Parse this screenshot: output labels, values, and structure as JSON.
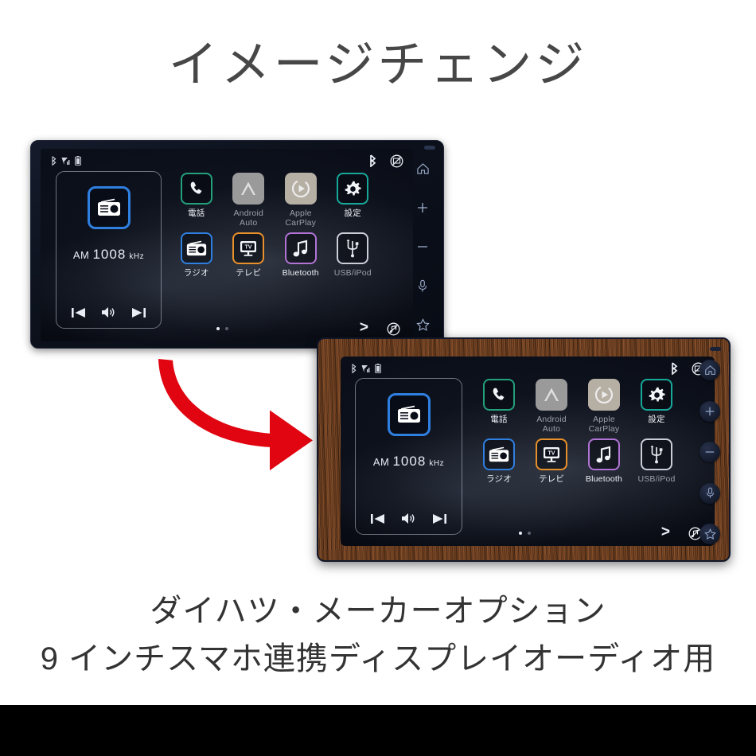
{
  "page": {
    "title": "イメージチェンジ",
    "caption_line1": "ダイハツ・メーカーオプション",
    "caption_line2": "9 インチスマホ連携ディスプレイオーディオ用"
  },
  "colors": {
    "title_text": "#474747",
    "caption_text": "#333333",
    "arrow_red": "#E00510",
    "accent_radio_blue": "#2F7FE0",
    "accent_phone_green": "#23A07C",
    "accent_settings_teal": "#18A89B",
    "accent_tv_orange": "#E8902A",
    "accent_bluetooth_purple": "#B173D6",
    "accent_usb_grey": "#C9CED8",
    "bezel_dark": "#0C111C",
    "bezel_wood": "#7A4522",
    "bottom_bar": "#000000"
  },
  "units": [
    {
      "variant": "dark",
      "bezel_label": "black-bezel",
      "statusbar": {
        "left_icons": [
          "bluetooth-icon",
          "signal-bars-icon",
          "battery-icon"
        ],
        "right_icons": [
          "bluetooth-icon",
          "no-display-icon"
        ]
      },
      "widget": {
        "source_icon": "radio-icon",
        "band": "AM",
        "frequency": "1008",
        "frequency_unit": "kHz",
        "controls": [
          "previous-track-icon",
          "volume-icon",
          "next-track-icon"
        ]
      },
      "apps": [
        {
          "label": "電話",
          "icon": "phone-icon",
          "style": "outlined",
          "color": "#23A07C",
          "dim": false
        },
        {
          "label": "Android\nAuto",
          "icon": "android-auto-icon",
          "style": "filled",
          "color": "#9A9A9A",
          "dim": true
        },
        {
          "label": "Apple\nCarPlay",
          "icon": "carplay-icon",
          "style": "filled",
          "color": "#B6AFA4",
          "dim": true
        },
        {
          "label": "設定",
          "icon": "gear-icon",
          "style": "outlined",
          "color": "#18A89B",
          "dim": false
        },
        {
          "label": "ラジオ",
          "icon": "radio-icon",
          "style": "outlined",
          "color": "#2F7FE0",
          "dim": false
        },
        {
          "label": "テレビ",
          "icon": "tv-icon",
          "style": "outlined",
          "color": "#E8902A",
          "dim": false
        },
        {
          "label": "Bluetooth",
          "icon": "music-note-icon",
          "style": "outlined",
          "color": "#B173D6",
          "dim": false
        },
        {
          "label": "USB/iPod",
          "icon": "usb-icon",
          "style": "outlined",
          "color": "#C9CED8",
          "dim": true
        }
      ],
      "footer": {
        "page_dots_total": 2,
        "page_dots_active": 1,
        "next_page_label": ">",
        "mute_icon": "mute-music-icon"
      },
      "hardware_buttons": [
        "home-icon",
        "plus-icon",
        "minus-icon",
        "microphone-icon",
        "star-icon"
      ]
    },
    {
      "variant": "wood",
      "bezel_label": "wood-grain-bezel",
      "statusbar": {
        "left_icons": [
          "bluetooth-icon",
          "signal-bars-icon",
          "battery-icon"
        ],
        "right_icons": [
          "bluetooth-icon",
          "no-display-icon"
        ]
      },
      "widget": {
        "source_icon": "radio-icon",
        "band": "AM",
        "frequency": "1008",
        "frequency_unit": "kHz",
        "controls": [
          "previous-track-icon",
          "volume-icon",
          "next-track-icon"
        ]
      },
      "apps": [
        {
          "label": "電話",
          "icon": "phone-icon",
          "style": "outlined",
          "color": "#23A07C",
          "dim": false
        },
        {
          "label": "Android\nAuto",
          "icon": "android-auto-icon",
          "style": "filled",
          "color": "#9A9A9A",
          "dim": true
        },
        {
          "label": "Apple\nCarPlay",
          "icon": "carplay-icon",
          "style": "filled",
          "color": "#B6AFA4",
          "dim": true
        },
        {
          "label": "設定",
          "icon": "gear-icon",
          "style": "outlined",
          "color": "#18A89B",
          "dim": false
        },
        {
          "label": "ラジオ",
          "icon": "radio-icon",
          "style": "outlined",
          "color": "#2F7FE0",
          "dim": false
        },
        {
          "label": "テレビ",
          "icon": "tv-icon",
          "style": "outlined",
          "color": "#E8902A",
          "dim": false
        },
        {
          "label": "Bluetooth",
          "icon": "music-note-icon",
          "style": "outlined",
          "color": "#B173D6",
          "dim": false
        },
        {
          "label": "USB/iPod",
          "icon": "usb-icon",
          "style": "outlined",
          "color": "#C9CED8",
          "dim": true
        }
      ],
      "footer": {
        "page_dots_total": 2,
        "page_dots_active": 1,
        "next_page_label": ">",
        "mute_icon": "mute-music-icon"
      },
      "hardware_buttons": [
        "home-icon",
        "plus-icon",
        "minus-icon",
        "microphone-icon",
        "star-icon"
      ]
    }
  ],
  "arrow": {
    "name": "curved-red-arrow",
    "direction": "down-right"
  }
}
